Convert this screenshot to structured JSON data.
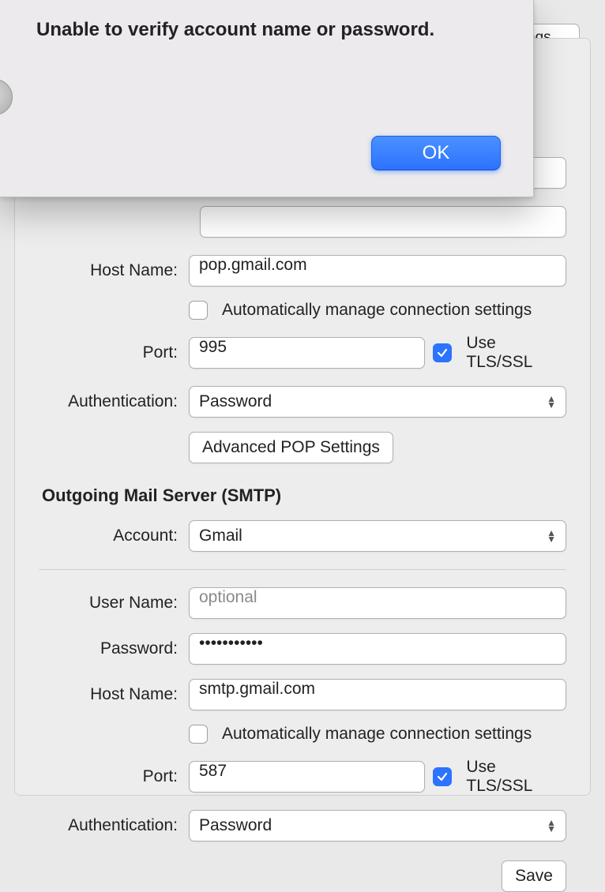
{
  "tab": {
    "partial_label": "ngs"
  },
  "alert": {
    "title": "Unable to verify account name or password.",
    "ok_label": "OK"
  },
  "labels": {
    "host_name": "Host Name:",
    "port": "Port:",
    "authentication": "Authentication:",
    "account": "Account:",
    "user_name": "User Name:",
    "password": "Password:"
  },
  "checkbox_labels": {
    "auto_manage": "Automatically manage connection settings",
    "use_tls": "Use TLS/SSL"
  },
  "incoming": {
    "host_name": "pop.gmail.com",
    "auto_manage": false,
    "port": "995",
    "use_tls": true,
    "auth_value": "Password",
    "advanced_button": "Advanced POP Settings"
  },
  "smtp": {
    "section_title": "Outgoing Mail Server (SMTP)",
    "account": "Gmail",
    "user_name": "",
    "user_name_placeholder": "optional",
    "password_display": "•••••••••••",
    "host_name": "smtp.gmail.com",
    "auto_manage": false,
    "port": "587",
    "use_tls": true,
    "auth_value": "Password"
  },
  "footer": {
    "save_label": "Save"
  }
}
